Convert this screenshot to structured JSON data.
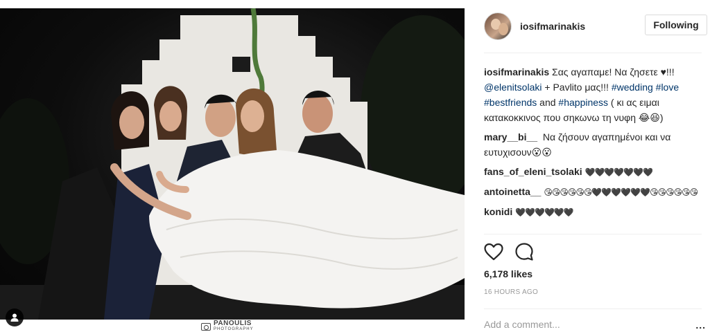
{
  "post": {
    "username": "iosifmarinakis",
    "follow_label": "Following",
    "watermark_top": "PANOULIS",
    "watermark_bottom": "PHOTOGRAPHY"
  },
  "caption": {
    "user": "iosifmarinakis",
    "text_1": " Σας αγαπαμε! Να ζησετε ♥!!! ",
    "mention": "@elenitsolaki",
    "text_2": " + Pavlito μας!!! ",
    "tag_1": "#wedding",
    "tag_2": "#love",
    "tag_3": "#bestfriends",
    "text_3": " and ",
    "tag_4": "#happiness",
    "text_4": " ( κι ας ειμαι κατακοκκινος που σηκωνω τη νυφη 😂😆)"
  },
  "comments": [
    {
      "user": "mary__bi__",
      "text": "Να ζήσουν αγαπημένοι και να ευτυχισουν😮😮"
    },
    {
      "user": "fans_of_eleni_tsolaki",
      "text": "🖤🖤🖤🖤🖤🖤🖤"
    },
    {
      "user": "antoinetta__",
      "text": "😘😘😘😘😘😘🖤🖤🖤🖤🖤🖤😘😘😘😘😘😘"
    },
    {
      "user": "konidi",
      "text": "🖤🖤🖤🖤🖤🖤"
    }
  ],
  "stats": {
    "likes": "6,178 likes",
    "time": "16 HOURS AGO"
  },
  "add_comment": {
    "placeholder": "Add a comment...",
    "more": "..."
  },
  "icons": {
    "like": "heart-icon",
    "comment": "comment-icon",
    "tag": "user-tag-icon",
    "more": "more-options-icon"
  }
}
